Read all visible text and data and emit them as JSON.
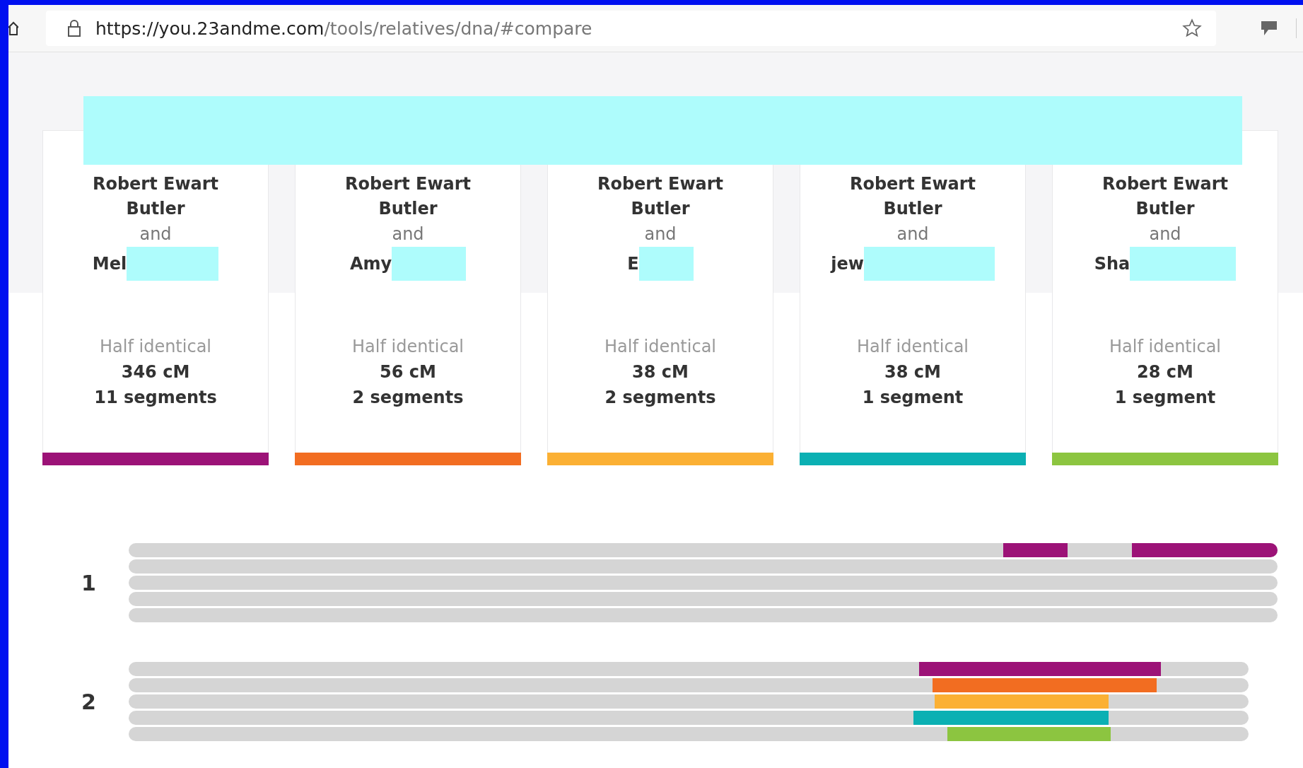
{
  "address_bar": {
    "host": "https://you.23andme.com",
    "path": "/tools/relatives/dna/#compare"
  },
  "cards": [
    {
      "person": "Robert Ewart Butler",
      "joiner": "and",
      "relative": "Mel",
      "match_type": "Half identical",
      "cm": "346 cM",
      "segments": "11 segments",
      "color": "#9c1277"
    },
    {
      "person": "Robert Ewart Butler",
      "joiner": "and",
      "relative": "Amy",
      "match_type": "Half identical",
      "cm": "56 cM",
      "segments": "2 segments",
      "color": "#f26d21"
    },
    {
      "person": "Robert Ewart Butler",
      "joiner": "and",
      "relative": "E",
      "match_type": "Half identical",
      "cm": "38 cM",
      "segments": "2 segments",
      "color": "#fbb034"
    },
    {
      "person": "Robert Ewart Butler",
      "joiner": "and",
      "relative": "jew",
      "match_type": "Half identical",
      "cm": "38 cM",
      "segments": "1 segment",
      "color": "#0bb0b3"
    },
    {
      "person": "Robert Ewart Butler",
      "joiner": "and",
      "relative": "Sha",
      "match_type": "Half identical",
      "cm": "28 cM",
      "segments": "1 segment",
      "color": "#8cc540"
    }
  ],
  "chromosomes": [
    {
      "label": "1"
    },
    {
      "label": "2"
    }
  ]
}
